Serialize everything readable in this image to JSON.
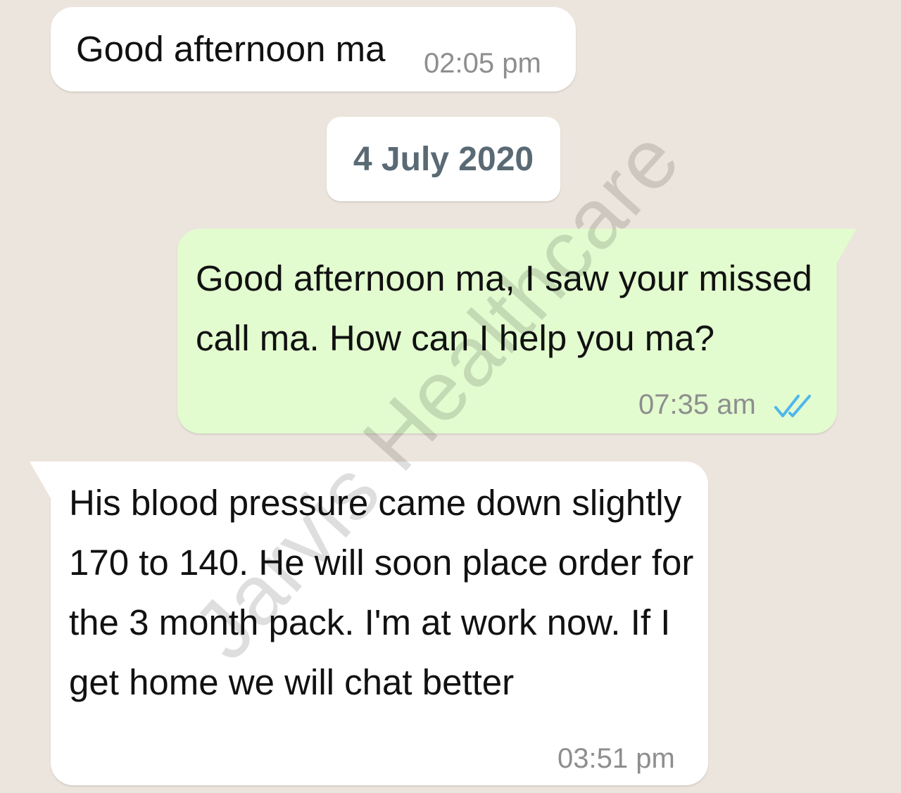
{
  "watermark": "Jarvis Healthcare",
  "messages": [
    {
      "direction": "incoming",
      "text": "Good afternoon ma",
      "time": "02:05 pm"
    },
    {
      "direction": "outgoing",
      "text": " Good afternoon ma, I saw your missed call ma. How can I help you ma?",
      "time": "07:35 am",
      "status_icon": "double-check-icon",
      "status_color": "#4fb6ec"
    },
    {
      "direction": "incoming",
      "text": " His blood pressure came down slightly 170 to 140. He will soon place order for the 3 month pack. I'm at work now. If I get home we will chat better",
      "time": "03:51 pm"
    }
  ],
  "date_separator": "4 July 2020",
  "colors": {
    "background": "#ece5dd",
    "incoming_bubble": "#ffffff",
    "outgoing_bubble": "#e2fbcf",
    "timestamp": "#8e8e8e",
    "date_chip_text": "#5a6a74"
  }
}
